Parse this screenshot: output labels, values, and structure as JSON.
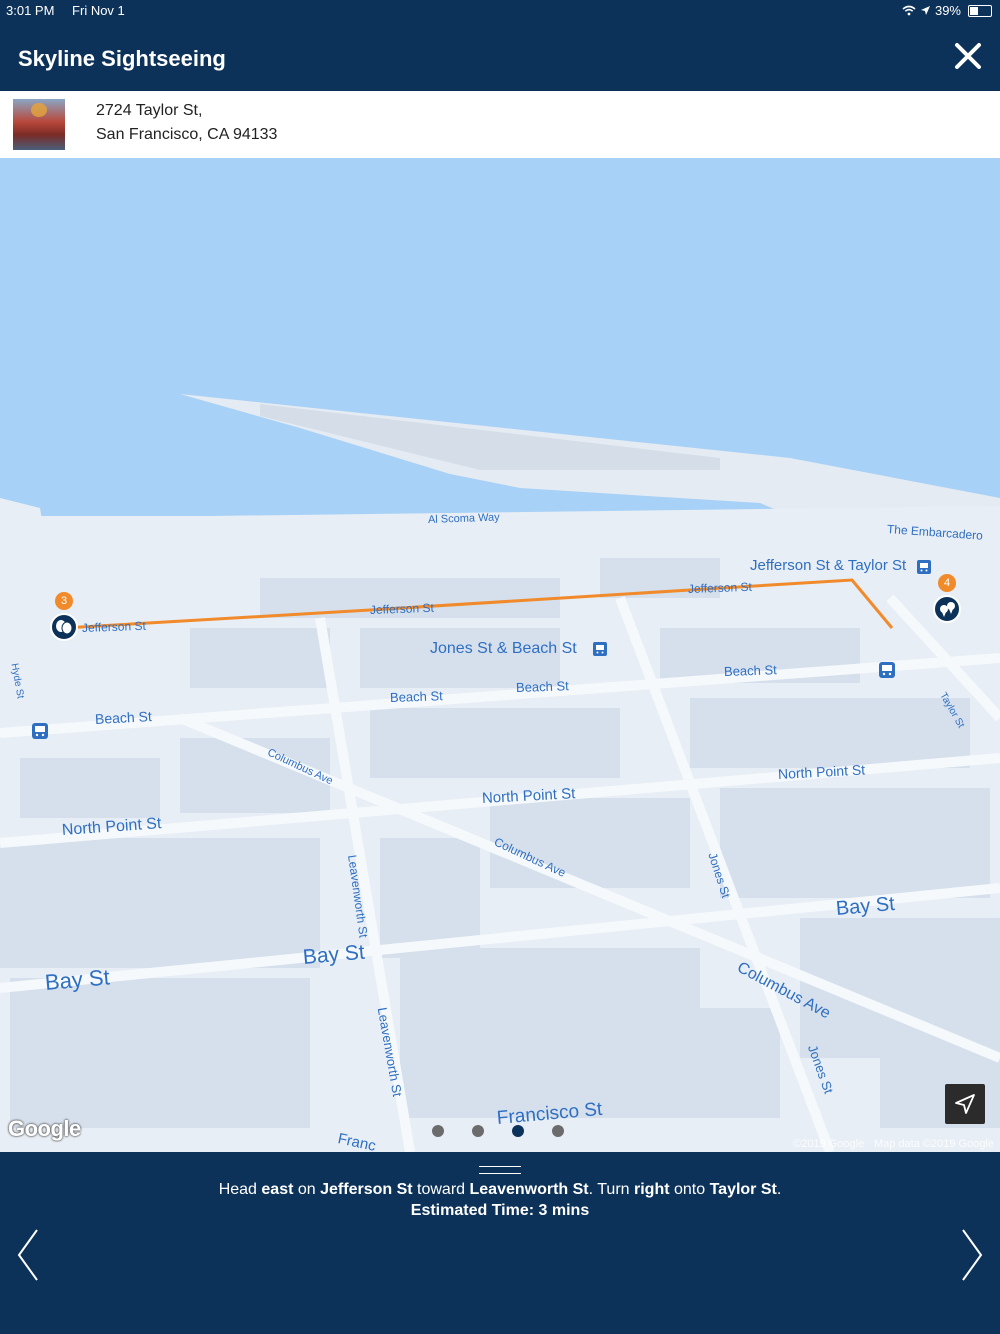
{
  "status_bar": {
    "time": "3:01 PM",
    "date": "Fri Nov 1",
    "battery": "39%",
    "icons": [
      "wifi-icon",
      "location-arrow-icon",
      "battery-icon"
    ]
  },
  "header": {
    "title": "Skyline Sightseeing",
    "close_icon": "close-icon"
  },
  "address": {
    "line1": "2724 Taylor St,",
    "line2": "San Francisco, CA 94133"
  },
  "map": {
    "labels": {
      "al_scoma_way": "Al Scoma Way",
      "the_embarcadero": "The Embarcadero",
      "jefferson_taylor_stop": "Jefferson St & Taylor St",
      "jefferson_st": "Jefferson St",
      "jones_beach_stop": "Jones St & Beach St",
      "beach_st": "Beach St",
      "columbus_ave": "Columbus Ave",
      "north_point_st": "North Point St",
      "jones_st": "Jones St",
      "leavenworth_st": "Leavenworth St",
      "bay_st": "Bay St",
      "francisco_st": "Francisco St",
      "franc_partial": "Franc",
      "taylor_st": "Taylor St",
      "hyde_st": "Hyde St"
    },
    "markers": [
      {
        "number": "3",
        "icon": "theater-masks-icon"
      },
      {
        "number": "4",
        "icon": "map-pins-icon"
      }
    ],
    "google_logo": "Google",
    "copyright": "©2019 Google · Map data ©2019 Google",
    "route_color": "#f08a2b"
  },
  "pager": {
    "count": 4,
    "active_index": 2
  },
  "directions": {
    "p1": "Head ",
    "b1": "east",
    "p2": " on ",
    "b2": "Jefferson St",
    "p3": " toward ",
    "b3": "Leavenworth St",
    "p4": ". Turn ",
    "b4": "right",
    "p5": " onto ",
    "b5": "Taylor St",
    "p6": ".",
    "estimated": "Estimated Time: 3 mins"
  },
  "colors": {
    "brand": "#0d3259",
    "water": "#a8d1f7",
    "land": "#e8eef5",
    "accent": "#f08a2b"
  }
}
